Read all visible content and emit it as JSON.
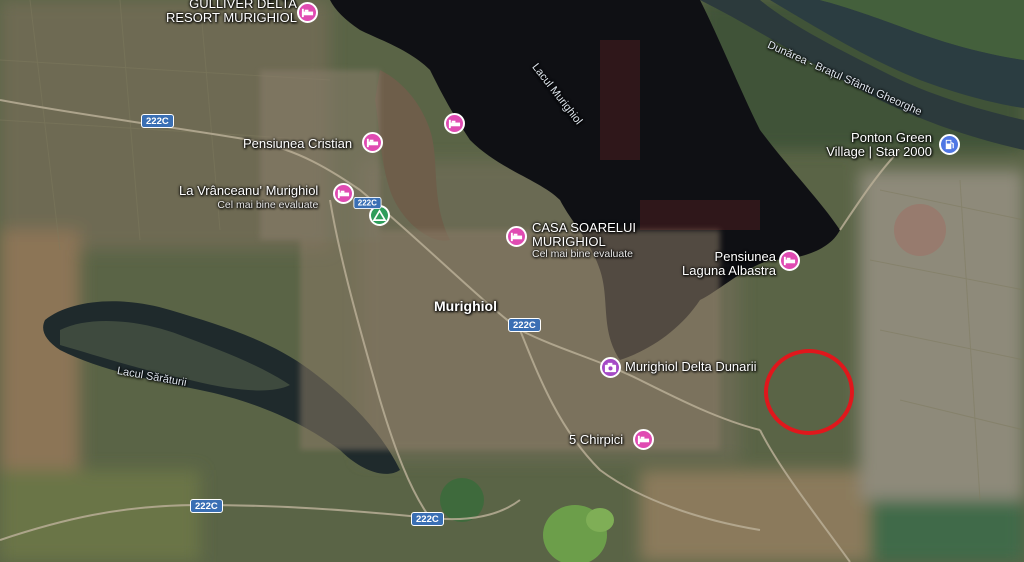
{
  "colors": {
    "lodging_pin": "#e04bb2",
    "attraction_pin": "#a54ac6",
    "fuel_pin": "#5077e4",
    "camp_pin": "#2e9d5b",
    "route_shield": "#3a6fb4",
    "highlight_ring": "#e0171c",
    "water": "#0f1014"
  },
  "places": {
    "town": "Murighiol",
    "lake_north": "Lacul Murighiol",
    "lake_south": "Lacul Sărăturii",
    "river": "Dunărea - Brațul Sfântu Gheorghe"
  },
  "pois": {
    "gulliver": {
      "line1": "GULLIVER DELTA",
      "line2": "RESORT MURIGHIOL",
      "icon": "bed-icon"
    },
    "cristian": {
      "name": "Pensiunea Cristian",
      "icon": "bed-icon"
    },
    "vranceanu": {
      "name": "La Vrânceanu' Murighiol",
      "sub": "Cel mai bine evaluate",
      "icon": "bed-icon"
    },
    "soarelui": {
      "line1": "CASA SOARELUI",
      "line2": "MURIGHIOL",
      "sub": "Cel mai bine evaluate",
      "icon": "bed-icon"
    },
    "laguna": {
      "line1": "Pensiunea",
      "line2": "Laguna Albastra",
      "icon": "bed-icon"
    },
    "ponton": {
      "line1": "Ponton Green",
      "line2": "Village | Star 2000",
      "icon": "fuel-icon"
    },
    "delta": {
      "name": "Murighiol Delta Dunarii",
      "icon": "camera-icon"
    },
    "chirpici": {
      "name": "5 Chirpici",
      "icon": "bed-icon"
    },
    "unnamed_bed": {
      "icon": "bed-icon"
    },
    "camp": {
      "icon": "campground-icon"
    }
  },
  "roads": {
    "shield_1": "222C",
    "shield_2": "222C",
    "shield_3": "222C",
    "shield_4": "222C",
    "shield_5": "222C"
  }
}
